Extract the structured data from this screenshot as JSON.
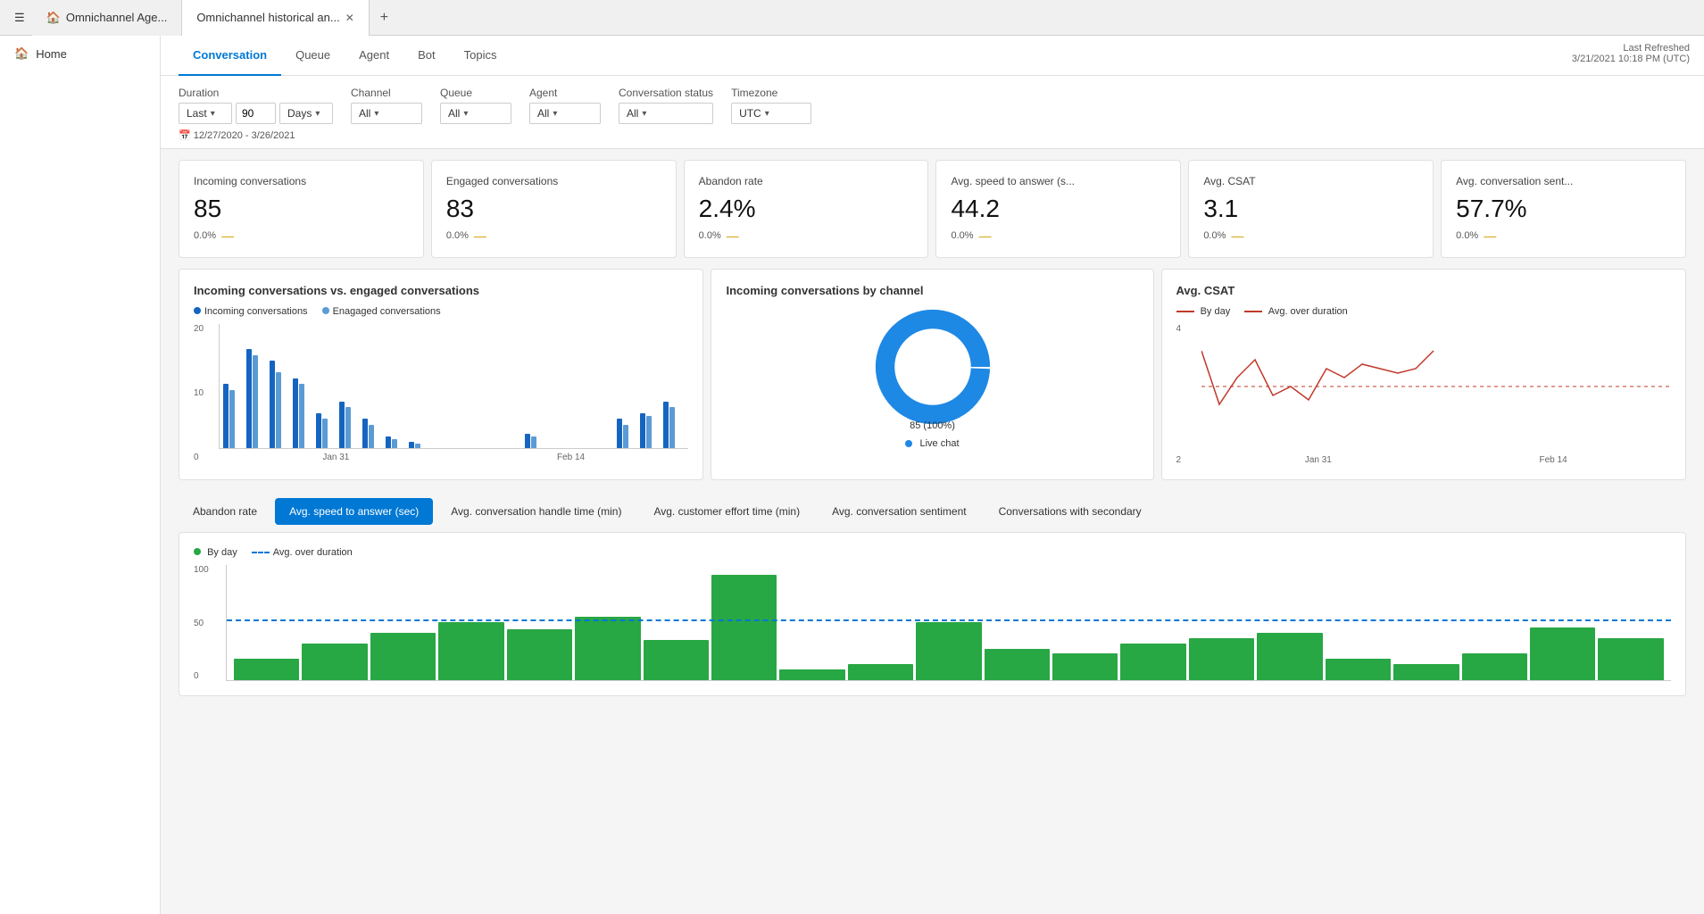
{
  "tabs": {
    "items": [
      {
        "label": "Omnichannel Age...",
        "active": false,
        "closable": false
      },
      {
        "label": "Omnichannel historical an...",
        "active": true,
        "closable": true
      }
    ]
  },
  "sidebar": {
    "home_label": "Home"
  },
  "nav": {
    "tabs": [
      {
        "label": "Conversation",
        "active": true
      },
      {
        "label": "Queue",
        "active": false
      },
      {
        "label": "Agent",
        "active": false
      },
      {
        "label": "Bot",
        "active": false
      },
      {
        "label": "Topics",
        "active": false
      }
    ],
    "last_refreshed_label": "Last Refreshed",
    "last_refreshed_value": "3/21/2021 10:18 PM (UTC)"
  },
  "filters": {
    "duration_label": "Duration",
    "duration_preset": "Last",
    "duration_value": "90",
    "duration_unit": "Days",
    "channel_label": "Channel",
    "channel_value": "All",
    "queue_label": "Queue",
    "queue_value": "All",
    "agent_label": "Agent",
    "agent_value": "All",
    "conv_status_label": "Conversation status",
    "conv_status_value": "All",
    "timezone_label": "Timezone",
    "timezone_value": "UTC",
    "date_range": "12/27/2020 - 3/26/2021"
  },
  "kpis": [
    {
      "title": "Incoming conversations",
      "value": "85",
      "change": "0.0%",
      "trend": "—"
    },
    {
      "title": "Engaged conversations",
      "value": "83",
      "change": "0.0%",
      "trend": "—"
    },
    {
      "title": "Abandon rate",
      "value": "2.4%",
      "change": "0.0%",
      "trend": "—"
    },
    {
      "title": "Avg. speed to answer (s...",
      "value": "44.2",
      "change": "0.0%",
      "trend": "—"
    },
    {
      "title": "Avg. CSAT",
      "value": "3.1",
      "change": "0.0%",
      "trend": "—"
    },
    {
      "title": "Avg. conversation sent...",
      "value": "57.7%",
      "change": "0.0%",
      "trend": "—"
    }
  ],
  "charts": {
    "bar_chart": {
      "title": "Incoming conversations vs. engaged conversations",
      "legend": [
        {
          "label": "Incoming conversations",
          "color": "#1565c0"
        },
        {
          "label": "Enagaged conversations",
          "color": "#5b9bd5"
        }
      ],
      "y_labels": [
        "20",
        "10",
        "0"
      ],
      "x_labels": [
        "Jan 31",
        "Feb 14"
      ],
      "bars": [
        {
          "inc": 55,
          "eng": 50
        },
        {
          "inc": 85,
          "eng": 80
        },
        {
          "inc": 75,
          "eng": 65
        },
        {
          "inc": 60,
          "eng": 55
        },
        {
          "inc": 30,
          "eng": 25
        },
        {
          "inc": 40,
          "eng": 35
        },
        {
          "inc": 25,
          "eng": 20
        },
        {
          "inc": 10,
          "eng": 8
        },
        {
          "inc": 5,
          "eng": 4
        },
        {
          "inc": 0,
          "eng": 0
        },
        {
          "inc": 0,
          "eng": 0
        },
        {
          "inc": 0,
          "eng": 0
        },
        {
          "inc": 0,
          "eng": 0
        },
        {
          "inc": 12,
          "eng": 10
        },
        {
          "inc": 0,
          "eng": 0
        },
        {
          "inc": 0,
          "eng": 0
        },
        {
          "inc": 0,
          "eng": 0
        },
        {
          "inc": 25,
          "eng": 20
        },
        {
          "inc": 30,
          "eng": 28
        },
        {
          "inc": 40,
          "eng": 35
        }
      ]
    },
    "donut_chart": {
      "title": "Incoming conversations by channel",
      "value": "85",
      "percent": "100%",
      "color": "#1e88e5",
      "legend_label": "Live chat"
    },
    "line_chart": {
      "title": "Avg. CSAT",
      "legend": [
        {
          "label": "By day",
          "color": "#c0392b",
          "style": "solid"
        },
        {
          "label": "Avg. over duration",
          "color": "#c0392b",
          "style": "dotted"
        }
      ],
      "x_labels": [
        "Jan 31",
        "Feb 14"
      ],
      "y_labels": [
        "4",
        "2"
      ]
    }
  },
  "bottom_tabs": [
    {
      "label": "Abandon rate",
      "active": false
    },
    {
      "label": "Avg. speed to answer (sec)",
      "active": true
    },
    {
      "label": "Avg. conversation handle time (min)",
      "active": false
    },
    {
      "label": "Avg. customer effort time (min)",
      "active": false
    },
    {
      "label": "Avg. conversation sentiment",
      "active": false
    },
    {
      "label": "Conversations with secondary",
      "active": false
    }
  ],
  "bottom_chart": {
    "legend": [
      {
        "label": "By day",
        "color": "#28a745"
      },
      {
        "label": "Avg. over duration",
        "color": "#0078d4",
        "style": "dashed"
      }
    ],
    "y_labels": [
      "100",
      "50",
      "0"
    ],
    "avg_line_pct": 47,
    "bars": [
      20,
      35,
      45,
      55,
      48,
      60,
      38,
      100,
      10,
      15,
      55,
      30,
      25,
      35,
      40,
      45,
      20,
      15,
      25,
      50,
      40
    ]
  }
}
